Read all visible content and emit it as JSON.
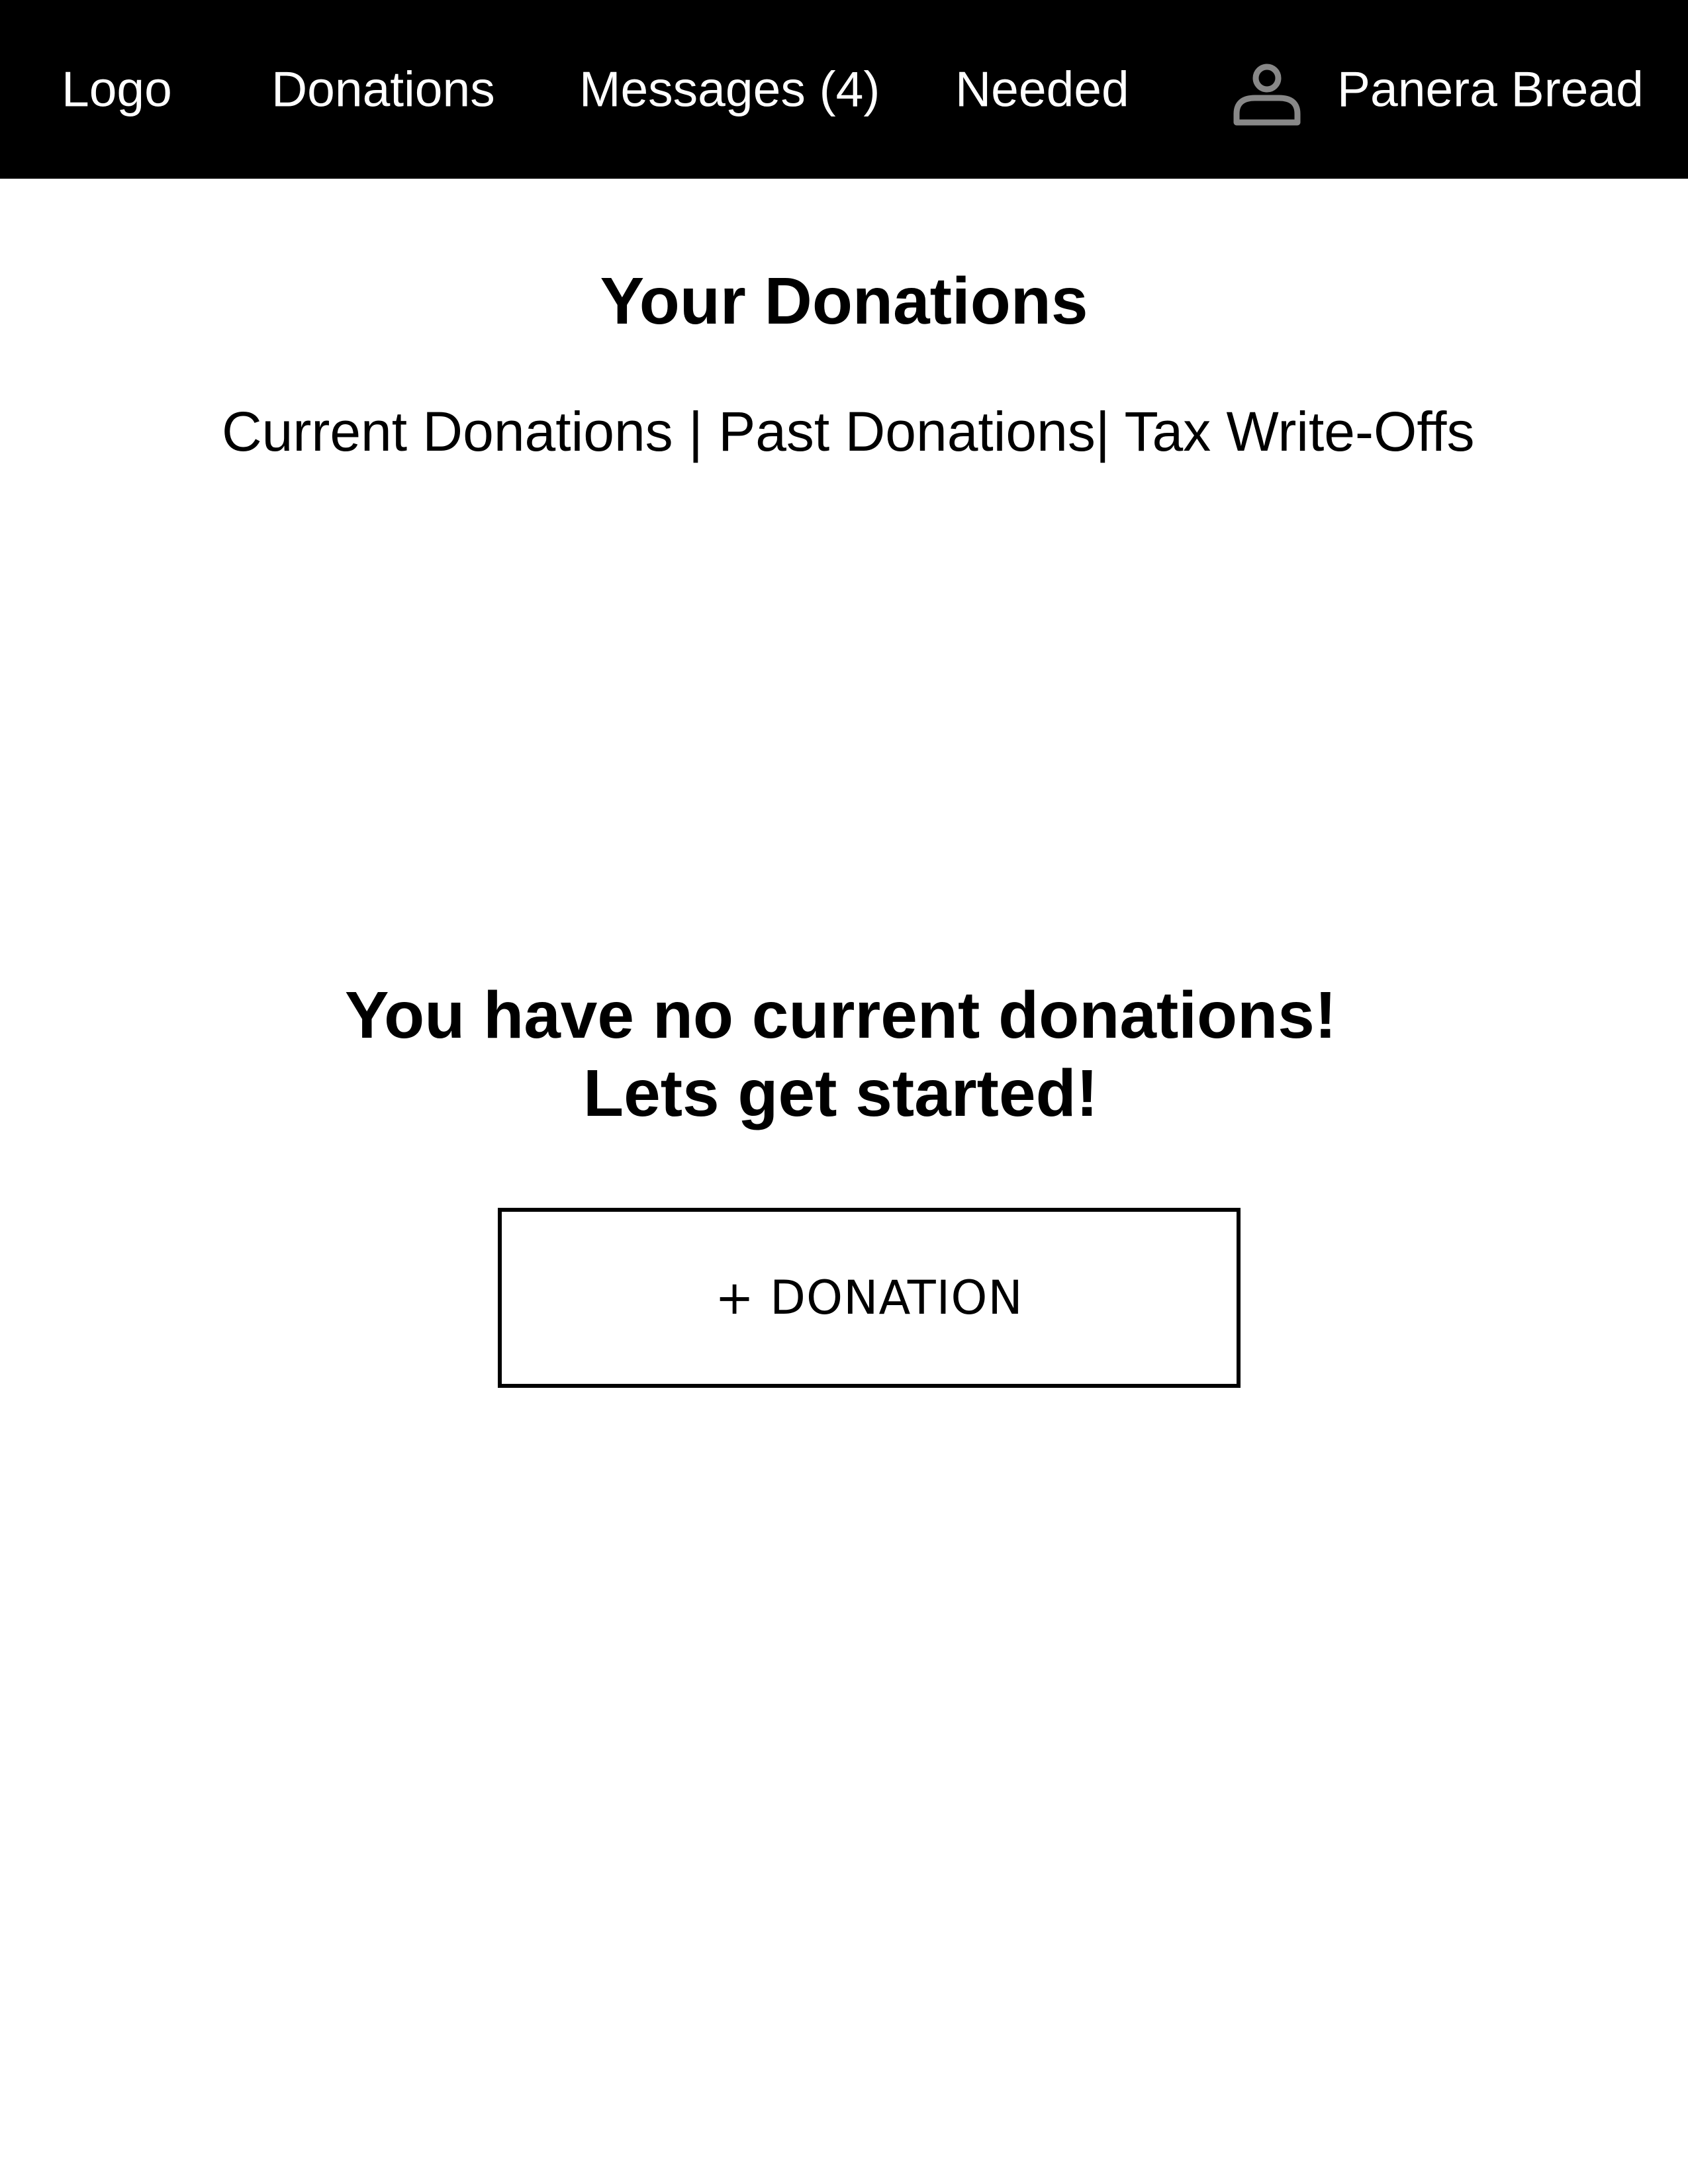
{
  "nav": {
    "logo": "Logo",
    "donations": "Donations",
    "messages": "Messages (4)",
    "needed": "Needed",
    "user_icon": "user-icon",
    "user_name": "Panera Bread"
  },
  "page": {
    "title": "Your Donations",
    "tabs": [
      {
        "label": "Current Donations"
      },
      {
        "label": "Past Donations"
      },
      {
        "label": "Tax Write-Offs"
      }
    ],
    "empty_line1": "You have no current donations!",
    "empty_line2": "Lets get started!",
    "add_button": "+ DONATION"
  },
  "colors": {
    "topbar_bg": "#000000",
    "topbar_text": "#ffffff",
    "icon_gray": "#888888"
  }
}
